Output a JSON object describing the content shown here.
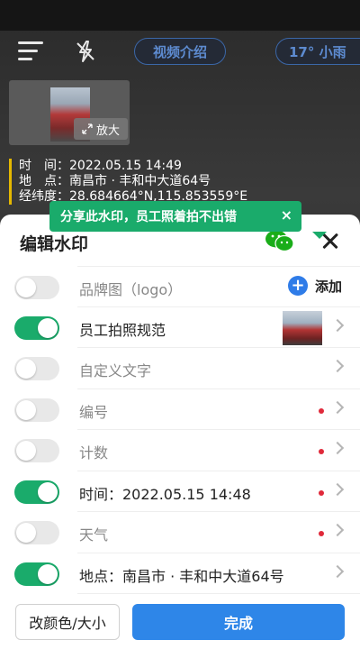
{
  "header": {
    "video_intro": "视频介绍",
    "weather": "17° 小雨"
  },
  "preview": {
    "zoom_label": "放大"
  },
  "watermark_info": {
    "time_line": "时　间：2022.05.15 14:49",
    "place_line": "地　点：南昌市 · 丰和中大道64号",
    "coord_line": "经纬度：28.684664°N,115.853559°E"
  },
  "tooltip": {
    "text": "分享此水印，员工照着拍不出错",
    "close": "×"
  },
  "sheet": {
    "title": "编辑水印",
    "rows": [
      {
        "label": "品牌图（logo）",
        "on": false,
        "action": "添加"
      },
      {
        "label": "员工拍照规范",
        "on": true,
        "has_image": true
      },
      {
        "label": "自定义文字",
        "on": false
      },
      {
        "label": "编号",
        "on": false,
        "dot": true
      },
      {
        "label": "计数",
        "on": false,
        "dot": true
      },
      {
        "label": "时间：2022.05.15 14:48",
        "on": true,
        "dot": true
      },
      {
        "label": "天气",
        "on": false,
        "dot": true
      },
      {
        "label": "地点：南昌市 · 丰和中大道64号",
        "on": true
      }
    ],
    "add_plus": "+",
    "btn_color_size": "改颜色/大小",
    "btn_done": "完成"
  },
  "colors": {
    "accent_green": "#1aab6b",
    "accent_blue": "#2e86e8",
    "dot_red": "#e0293a"
  }
}
